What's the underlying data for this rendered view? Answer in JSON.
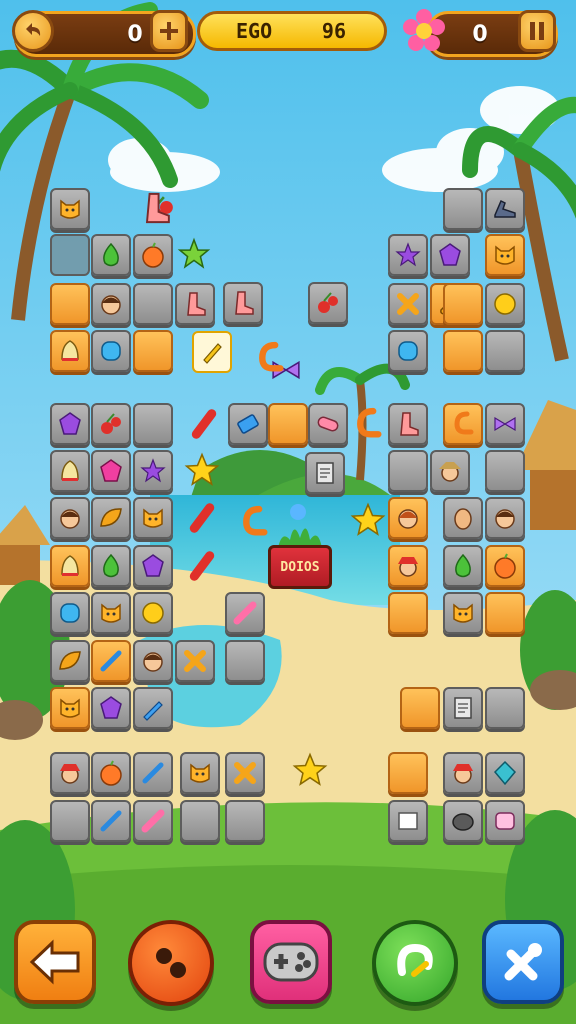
{
  "hud": {
    "left_counter": "0",
    "level_left": "EGO",
    "level_right": "96",
    "right_counter": "0"
  },
  "sign": {
    "text": "DOIOS"
  },
  "colors": {
    "sky": "#56c6ee",
    "ocean": "#3fc4d8",
    "sand": "#f3dfa0",
    "grass": "#6cbf3a",
    "tile_gray": "#a0a0a0",
    "tile_orange": "#f5a83a",
    "hud_brown": "#6a3410",
    "hud_gold": "#f5b800"
  },
  "icons": {
    "undo": "undo-arrow-icon",
    "add": "plus-icon",
    "flower": "flower-icon",
    "pause": "pause-icon",
    "back": "back-arrow-icon",
    "bomb": "bomb-icon",
    "gamepad": "gamepad-icon",
    "magnet": "magnet-icon",
    "tool": "wrench-icon"
  },
  "tiles": [
    {
      "name": "tile-empty",
      "style": "empty",
      "icon": "none"
    },
    {
      "name": "tile-green-gem",
      "style": "gray",
      "icon": "green-gem-icon"
    },
    {
      "name": "tile-apple",
      "style": "gray",
      "icon": "orange-apple-icon"
    },
    {
      "name": "tile-empty",
      "style": "orange",
      "icon": "none"
    },
    {
      "name": "tile-boy",
      "style": "gray",
      "icon": "boy-face-icon"
    },
    {
      "name": "tile-empty",
      "style": "gray",
      "icon": "none"
    },
    {
      "name": "tile-boot",
      "style": "gray",
      "icon": "boot-icon"
    },
    {
      "name": "tile-bell",
      "style": "orange",
      "icon": "bell-icon"
    },
    {
      "name": "tile-blue-gem",
      "style": "gray",
      "icon": "blue-gem-icon"
    },
    {
      "name": "tile-empty",
      "style": "orange",
      "icon": "none"
    },
    {
      "name": "tile-purple-gem",
      "style": "gray",
      "icon": "purple-gem-icon"
    },
    {
      "name": "tile-cherry",
      "style": "gray",
      "icon": "cherry-icon"
    },
    {
      "name": "tile-empty",
      "style": "gray",
      "icon": "none"
    },
    {
      "name": "tile-bell",
      "style": "gray",
      "icon": "bell-icon"
    },
    {
      "name": "tile-pink-gem",
      "style": "gray",
      "icon": "pink-gem-icon"
    },
    {
      "name": "tile-star",
      "style": "gray",
      "icon": "purple-star-icon"
    },
    {
      "name": "tile-boy",
      "style": "gray",
      "icon": "boy-face-icon"
    },
    {
      "name": "tile-leaf",
      "style": "gray",
      "icon": "leaf-icon"
    },
    {
      "name": "tile-cat",
      "style": "gray",
      "icon": "cat-icon"
    },
    {
      "name": "tile-bell",
      "style": "orange",
      "icon": "bell-icon"
    },
    {
      "name": "tile-green-gem",
      "style": "gray",
      "icon": "green-gem-icon"
    },
    {
      "name": "tile-purple-gem",
      "style": "gray",
      "icon": "purple-gem-icon"
    },
    {
      "name": "tile-blue-gem",
      "style": "gray",
      "icon": "blue-gem-icon"
    },
    {
      "name": "tile-cat",
      "style": "gray",
      "icon": "cat-icon"
    },
    {
      "name": "tile-coin",
      "style": "gray",
      "icon": "gold-coin-icon"
    },
    {
      "name": "tile-leaf",
      "style": "gray",
      "icon": "leaf-icon"
    },
    {
      "name": "tile-stick",
      "style": "orange",
      "icon": "stick-icon"
    },
    {
      "name": "tile-boy",
      "style": "gray",
      "icon": "boy-face-icon"
    },
    {
      "name": "tile-cross",
      "style": "gray",
      "icon": "cross-icon"
    },
    {
      "name": "tile-empty",
      "style": "gray",
      "icon": "none"
    },
    {
      "name": "tile-cat",
      "style": "orange",
      "icon": "cat-icon"
    },
    {
      "name": "tile-purple-gem",
      "style": "gray",
      "icon": "purple-gem-icon"
    },
    {
      "name": "tile-pencil",
      "style": "gray",
      "icon": "pencil-icon"
    },
    {
      "name": "tile-fireman",
      "style": "gray",
      "icon": "fireman-icon"
    },
    {
      "name": "tile-apple",
      "style": "gray",
      "icon": "orange-apple-icon"
    },
    {
      "name": "tile-stick",
      "style": "gray",
      "icon": "stick-icon"
    },
    {
      "name": "tile-cat",
      "style": "gray",
      "icon": "cat-icon"
    },
    {
      "name": "tile-cross",
      "style": "gray",
      "icon": "cross-icon"
    },
    {
      "name": "tile-empty",
      "style": "gray",
      "icon": "none"
    },
    {
      "name": "tile-stick",
      "style": "gray",
      "icon": "stick-icon"
    },
    {
      "name": "tile-lollipop",
      "style": "gray",
      "icon": "lollipop-icon"
    },
    {
      "name": "tile-empty",
      "style": "gray",
      "icon": "none"
    },
    {
      "name": "tile-empty",
      "style": "gray",
      "icon": "none"
    },
    {
      "name": "tile-boot",
      "style": "gray",
      "icon": "boot-icon"
    },
    {
      "name": "tile-cherry",
      "style": "gray",
      "icon": "cherry-icon"
    },
    {
      "name": "tile-cat",
      "style": "gray",
      "icon": "cat-icon"
    },
    {
      "name": "tile-pen",
      "style": "sel",
      "icon": "pen-icon"
    },
    {
      "name": "tile-battery",
      "style": "gray",
      "icon": "battery-icon"
    },
    {
      "name": "tile-empty",
      "style": "orange",
      "icon": "none"
    },
    {
      "name": "tile-pink-candy",
      "style": "gray",
      "icon": "pink-candy-icon"
    },
    {
      "name": "tile-notepad",
      "style": "gray",
      "icon": "notepad-icon"
    },
    {
      "name": "tile-lollipop",
      "style": "gray",
      "icon": "lollipop-icon"
    },
    {
      "name": "tile-empty",
      "style": "gray",
      "icon": "none"
    },
    {
      "name": "tile-shoe",
      "style": "gray",
      "icon": "shoe-icon"
    },
    {
      "name": "tile-star",
      "style": "gray",
      "icon": "purple-star-icon"
    },
    {
      "name": "tile-purple-gem",
      "style": "gray",
      "icon": "purple-gem-icon"
    },
    {
      "name": "tile-cat",
      "style": "orange",
      "icon": "cat-icon"
    },
    {
      "name": "tile-cross",
      "style": "gray",
      "icon": "cross-icon"
    },
    {
      "name": "tile-bread",
      "style": "orange",
      "icon": "bread-icon"
    },
    {
      "name": "tile-empty",
      "style": "orange",
      "icon": "none"
    },
    {
      "name": "tile-coin",
      "style": "gray",
      "icon": "gold-coin-icon"
    },
    {
      "name": "tile-blue-gem",
      "style": "gray",
      "icon": "blue-gem-icon"
    },
    {
      "name": "tile-empty",
      "style": "orange",
      "icon": "none"
    },
    {
      "name": "tile-empty",
      "style": "gray",
      "icon": "none"
    },
    {
      "name": "tile-boot",
      "style": "gray",
      "icon": "boot-icon"
    },
    {
      "name": "tile-hook",
      "style": "orange",
      "icon": "hook-icon"
    },
    {
      "name": "tile-bow",
      "style": "gray",
      "icon": "purple-bow-icon"
    },
    {
      "name": "tile-empty",
      "style": "gray",
      "icon": "none"
    },
    {
      "name": "tile-scout",
      "style": "gray",
      "icon": "scout-icon"
    },
    {
      "name": "tile-empty",
      "style": "gray",
      "icon": "none"
    },
    {
      "name": "tile-girl",
      "style": "orange",
      "icon": "girl-face-icon"
    },
    {
      "name": "tile-face",
      "style": "gray",
      "icon": "face-icon"
    },
    {
      "name": "tile-boy",
      "style": "gray",
      "icon": "boy-face-icon"
    },
    {
      "name": "tile-fireman",
      "style": "orange",
      "icon": "fireman-icon"
    },
    {
      "name": "tile-green-gem",
      "style": "gray",
      "icon": "green-gem-icon"
    },
    {
      "name": "tile-apple",
      "style": "orange",
      "icon": "orange-apple-icon"
    },
    {
      "name": "tile-empty",
      "style": "orange",
      "icon": "none"
    },
    {
      "name": "tile-cat",
      "style": "gray",
      "icon": "cat-icon"
    },
    {
      "name": "tile-empty",
      "style": "orange",
      "icon": "none"
    },
    {
      "name": "tile-empty",
      "style": "orange",
      "icon": "none"
    },
    {
      "name": "tile-notepad",
      "style": "gray",
      "icon": "notepad-icon"
    },
    {
      "name": "tile-empty",
      "style": "gray",
      "icon": "none"
    },
    {
      "name": "tile-empty",
      "style": "orange",
      "icon": "none"
    },
    {
      "name": "tile-fireman",
      "style": "gray",
      "icon": "fireman-icon"
    },
    {
      "name": "tile-diamond",
      "style": "gray",
      "icon": "diamond-icon"
    },
    {
      "name": "tile-paper",
      "style": "gray",
      "icon": "paper-icon"
    },
    {
      "name": "tile-rock",
      "style": "gray",
      "icon": "rock-icon"
    },
    {
      "name": "tile-mask",
      "style": "gray",
      "icon": "mask-icon"
    },
    {
      "name": "tile-pencil",
      "style": "gray",
      "icon": "pencil-icon"
    }
  ],
  "floating_items": [
    {
      "name": "floating-green-star",
      "icon": "green-star-icon"
    },
    {
      "name": "floating-cherry",
      "icon": "cherry-icon"
    },
    {
      "name": "floating-bow",
      "icon": "purple-bow-icon"
    },
    {
      "name": "floating-hook",
      "icon": "hook-icon"
    },
    {
      "name": "floating-yellow-star",
      "icon": "yellow-star-icon"
    },
    {
      "name": "floating-candy",
      "icon": "red-candy-icon"
    },
    {
      "name": "floating-candy",
      "icon": "red-candy-icon"
    },
    {
      "name": "floating-yellow-star",
      "icon": "yellow-star-icon"
    },
    {
      "name": "floating-hook",
      "icon": "hook-icon"
    },
    {
      "name": "floating-candy",
      "icon": "red-candy-icon"
    },
    {
      "name": "floating-yellow-star",
      "icon": "yellow-star-icon"
    },
    {
      "name": "floating-hook",
      "icon": "hook-icon"
    },
    {
      "name": "floating-boot",
      "icon": "boot-icon"
    }
  ]
}
